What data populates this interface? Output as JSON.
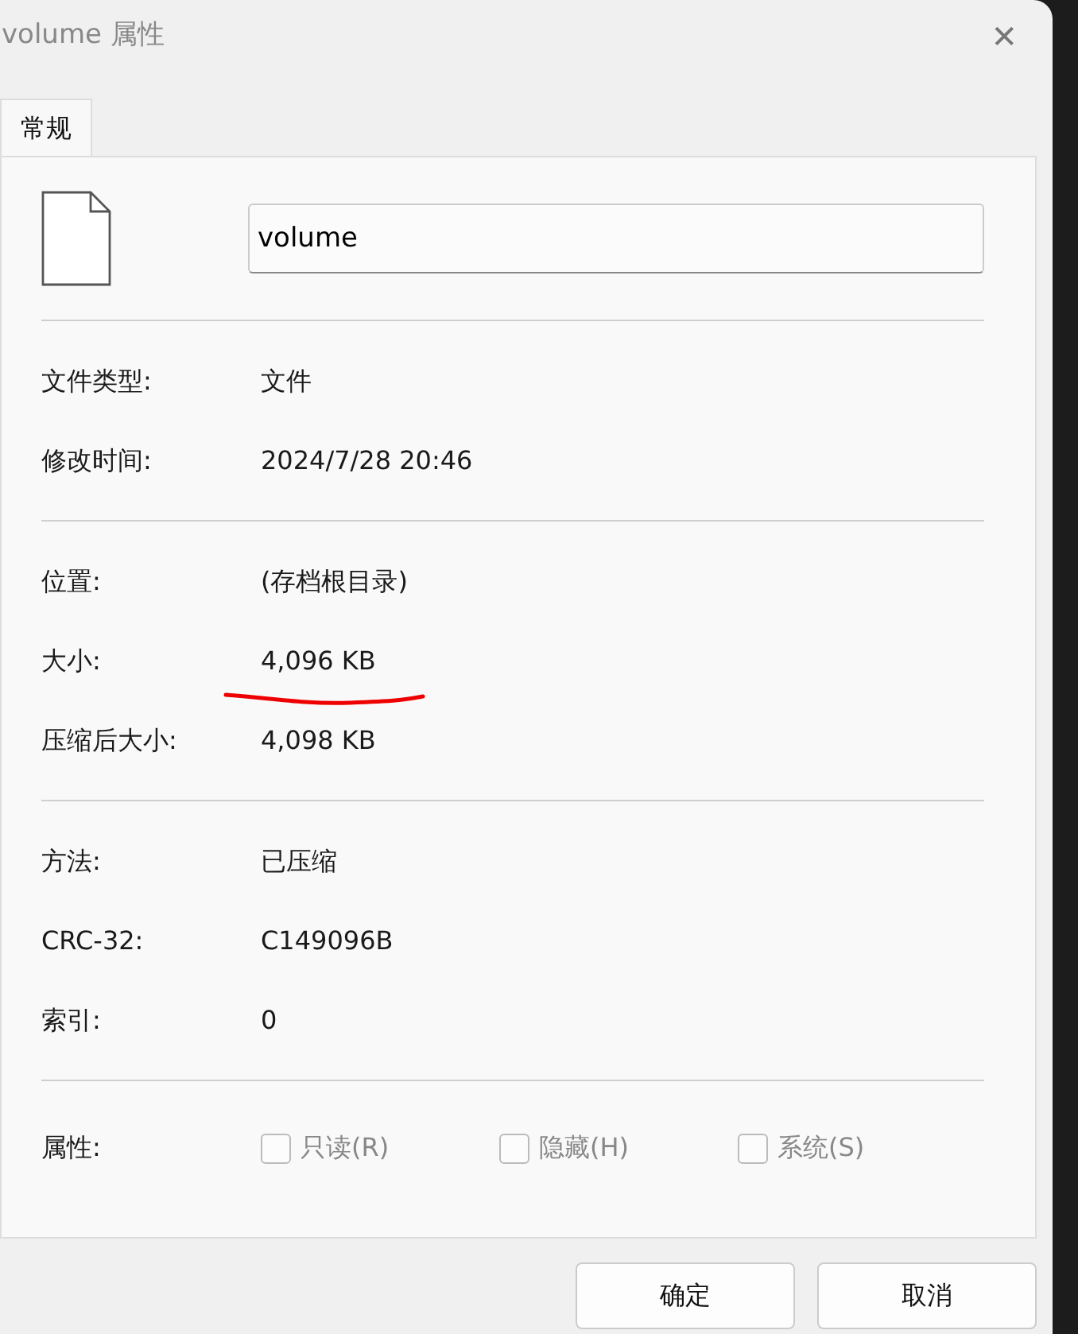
{
  "window": {
    "title": "volume 属性",
    "close": "✕"
  },
  "tabs": [
    {
      "label": "常规",
      "selected": true
    }
  ],
  "file": {
    "name": "volume"
  },
  "groups": [
    [
      {
        "label": "文件类型:",
        "value": "文件"
      },
      {
        "label": "修改时间:",
        "value": "2024/7/28 20:46"
      }
    ],
    [
      {
        "label": "位置:",
        "value": "(存档根目录)"
      },
      {
        "label": "大小:",
        "value": "4,096 KB"
      },
      {
        "label": "压缩后大小:",
        "value": "4,098 KB"
      }
    ],
    [
      {
        "label": "方法:",
        "value": "已压缩"
      },
      {
        "label": "CRC-32:",
        "value": "C149096B"
      },
      {
        "label": "索引:",
        "value": "0"
      }
    ]
  ],
  "attributes": {
    "label": "属性:",
    "options": [
      {
        "label": "只读(R)",
        "checked": false,
        "disabled": true
      },
      {
        "label": "隐藏(H)",
        "checked": false,
        "disabled": true
      },
      {
        "label": "系统(S)",
        "checked": false,
        "disabled": true
      }
    ]
  },
  "buttons": [
    "确定",
    "取消"
  ]
}
